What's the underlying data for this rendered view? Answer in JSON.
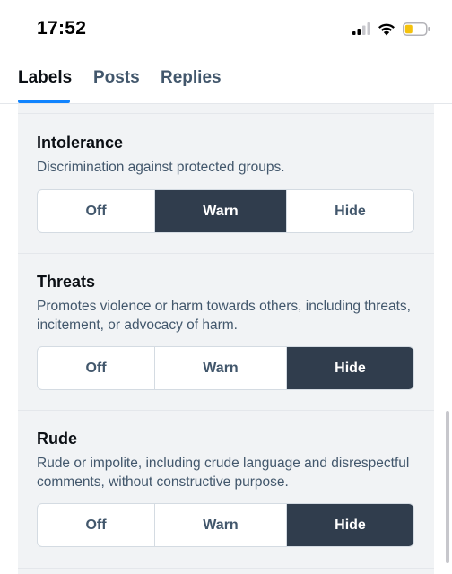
{
  "status": {
    "time": "17:52",
    "icons": [
      "cellular-signal-icon",
      "wifi-icon",
      "battery-low-icon"
    ]
  },
  "tabs": [
    {
      "label": "Labels",
      "active": true
    },
    {
      "label": "Posts",
      "active": false
    },
    {
      "label": "Replies",
      "active": false
    }
  ],
  "colors": {
    "accent": "#1083fe",
    "selected_segment": "#303d4d",
    "panel_bg": "#f1f3f5",
    "battery_fill": "#f4c20d"
  },
  "labels": [
    {
      "title": "Intolerance",
      "description": "Discrimination against protected groups.",
      "options": [
        "Off",
        "Warn",
        "Hide"
      ],
      "selected": "Warn"
    },
    {
      "title": "Threats",
      "description": "Promotes violence or harm towards others, including threats, incitement, or advocacy of harm.",
      "options": [
        "Off",
        "Warn",
        "Hide"
      ],
      "selected": "Hide"
    },
    {
      "title": "Rude",
      "description": "Rude or impolite, including crude language and disrespectful comments, without constructive purpose.",
      "options": [
        "Off",
        "Warn",
        "Hide"
      ],
      "selected": "Hide"
    }
  ]
}
